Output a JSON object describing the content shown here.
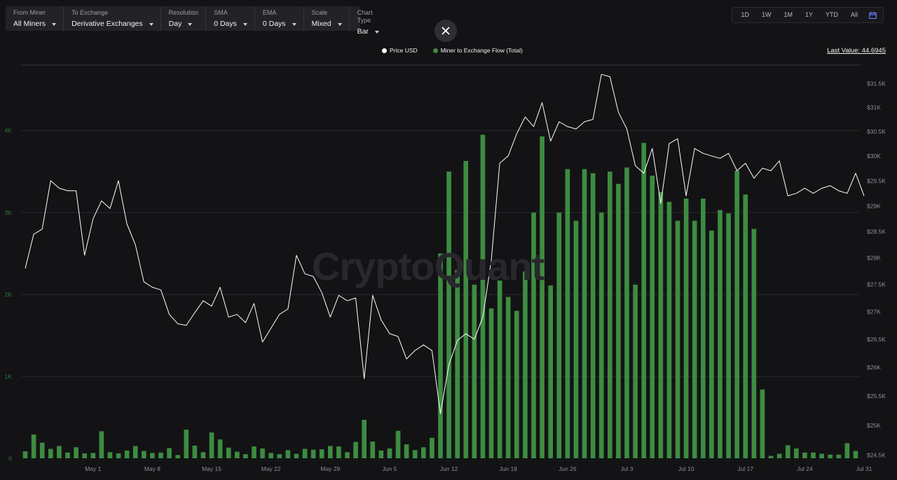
{
  "toolbar": {
    "from_miner": {
      "label": "From Miner",
      "value": "All Miners"
    },
    "to_exchange": {
      "label": "To Exchange",
      "value": "Derivative Exchanges"
    },
    "resolution": {
      "label": "Resolution",
      "value": "Day"
    },
    "sma": {
      "label": "SMA",
      "value": "0 Days"
    },
    "ema": {
      "label": "EMA",
      "value": "0 Days"
    },
    "scale": {
      "label": "Scale",
      "value": "Mixed"
    },
    "chart_type": {
      "label": "Chart Type",
      "value": "Bar"
    }
  },
  "range_buttons": [
    "1D",
    "1W",
    "1M",
    "1Y",
    "YTD",
    "All"
  ],
  "legend": {
    "price": "Price USD",
    "flow": "Miner to Exchange Flow (Total)"
  },
  "last_value": "Last Value: 44.6945",
  "watermark": "CryptoQuant",
  "colors": {
    "background": "#131315",
    "flow_bar": "#3d8c40",
    "price_line": "#ffffff",
    "grid": "#2a2a2e",
    "left_axis_text": "#2f7a3a",
    "right_axis_text": "#8d8d94"
  },
  "icons": {
    "close": "close-icon",
    "calendar": "calendar-icon",
    "dropdown": "chevron-down-icon"
  },
  "chart_data": {
    "type": "bar",
    "x_start": "2023-04-23",
    "x_end": "2023-08-01",
    "xticks": [
      "May 1",
      "May 8",
      "May 15",
      "May 22",
      "May 29",
      "Jun 5",
      "Jun 12",
      "Jun 19",
      "Jun 26",
      "Jul 3",
      "Jul 10",
      "Jul 17",
      "Jul 24",
      "Jul 31"
    ],
    "left_ylim": [
      0,
      4800
    ],
    "left_yticks": [
      "0",
      "1K",
      "2K",
      "3K",
      "4K"
    ],
    "right_ylim": [
      24450,
      31900
    ],
    "right_yticks": [
      "$24.5K",
      "$25K",
      "$25.5K",
      "$26K",
      "$26.5K",
      "$27K",
      "$27.5K",
      "$28K",
      "$28.5K",
      "$29K",
      "$29.5K",
      "$30K",
      "$30.5K",
      "$31K",
      "$31.5K"
    ],
    "log_scale_right": true,
    "grid": true,
    "series": [
      {
        "name": "Miner to Exchange Flow (Total)",
        "axis": "left",
        "values": [
          85,
          290,
          190,
          115,
          150,
          70,
          135,
          60,
          65,
          330,
          75,
          60,
          95,
          150,
          90,
          65,
          70,
          125,
          40,
          350,
          155,
          75,
          315,
          230,
          130,
          80,
          50,
          145,
          120,
          65,
          50,
          100,
          55,
          115,
          105,
          110,
          150,
          145,
          75,
          200,
          470,
          205,
          95,
          120,
          335,
          170,
          100,
          135,
          250,
          2500,
          3500,
          2300,
          3630,
          2120,
          3950,
          1830,
          2170,
          1970,
          1800,
          2280,
          3000,
          3930,
          2110,
          3000,
          3530,
          2900,
          3530,
          3480,
          3000,
          3500,
          3350,
          3550,
          2120,
          3850,
          3450,
          3250,
          3130,
          2900,
          3170,
          2900,
          3170,
          2780,
          3030,
          2990,
          3510,
          3220,
          2800,
          840,
          30,
          55,
          160,
          120,
          70,
          70,
          55,
          45,
          45,
          185,
          90
        ]
      },
      {
        "name": "Price USD",
        "axis": "right",
        "values": [
          27800,
          28450,
          28550,
          29500,
          29350,
          29300,
          29300,
          28050,
          28750,
          29100,
          28950,
          29500,
          28650,
          28250,
          27550,
          27450,
          27400,
          26950,
          26780,
          26750,
          26980,
          27200,
          27100,
          27450,
          26900,
          26950,
          26800,
          27150,
          26450,
          26700,
          26950,
          27050,
          28050,
          27700,
          27650,
          27350,
          26900,
          27300,
          27200,
          27250,
          25800,
          27300,
          26850,
          26600,
          26550,
          26150,
          26300,
          26400,
          26300,
          25200,
          26050,
          26480,
          26600,
          26500,
          26900,
          27950,
          29850,
          30000,
          30450,
          30800,
          30600,
          31100,
          30300,
          30700,
          30600,
          30550,
          30700,
          30750,
          31700,
          31650,
          30900,
          30550,
          29800,
          29650,
          30150,
          29050,
          30250,
          30350,
          29200,
          30150,
          30050,
          30000,
          29950,
          30050,
          29700,
          29850,
          29550,
          29750,
          29700,
          29900,
          29200,
          29250,
          29350,
          29250,
          29350,
          29400,
          29300,
          29250,
          29650,
          29200
        ]
      }
    ]
  }
}
